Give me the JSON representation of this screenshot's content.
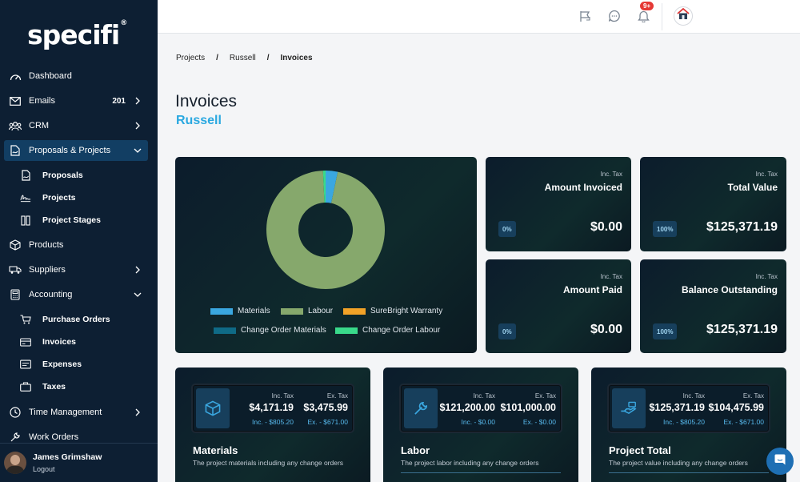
{
  "brand": {
    "logo_text": "specifi",
    "reg_mark": "®"
  },
  "sidebar": {
    "items": [
      {
        "label": "Dashboard",
        "icon": "dashboard-icon"
      },
      {
        "label": "Emails",
        "count": "201",
        "icon": "mail-icon"
      },
      {
        "label": "CRM",
        "icon": "users-icon"
      },
      {
        "label": "Proposals & Projects",
        "icon": "proposals-icon",
        "active": true
      },
      {
        "label": "Products",
        "icon": "box-icon"
      },
      {
        "label": "Suppliers",
        "icon": "truck-icon"
      },
      {
        "label": "Accounting",
        "icon": "calculator-icon"
      },
      {
        "label": "Time Management",
        "icon": "clock-icon"
      },
      {
        "label": "Work Orders",
        "icon": "tools-icon"
      }
    ],
    "projects_sub": [
      {
        "label": "Proposals",
        "icon": "document-icon"
      },
      {
        "label": "Projects",
        "icon": "signature-icon"
      },
      {
        "label": "Project Stages",
        "icon": "columns-icon"
      }
    ],
    "accounting_sub": [
      {
        "label": "Purchase Orders",
        "icon": "cart-icon"
      },
      {
        "label": "Invoices",
        "icon": "invoice-icon"
      },
      {
        "label": "Expenses",
        "icon": "wallet-icon"
      },
      {
        "label": "Taxes",
        "icon": "briefcase-icon"
      }
    ],
    "user": {
      "name": "James Grimshaw",
      "logout": "Logout"
    }
  },
  "topbar": {
    "notification_badge": "9+"
  },
  "breadcrumb": {
    "items": [
      "Projects",
      "Russell",
      "Invoices"
    ],
    "separator": "/"
  },
  "page": {
    "title": "Invoices",
    "subtitle": "Russell"
  },
  "chart_data": {
    "type": "pie",
    "variant": "donut",
    "slices": [
      {
        "label": "Materials",
        "value": 3.3,
        "color": "#3aa7e0"
      },
      {
        "label": "Labour",
        "value": 96.0,
        "color": "#86a86c"
      },
      {
        "label": "SureBright Warranty",
        "value": 0.0,
        "color": "#f2a227"
      },
      {
        "label": "Change Order Materials",
        "value": 0.0,
        "color": "#0f6a86"
      },
      {
        "label": "Change Order Labour",
        "value": 0.7,
        "color": "#39d98a"
      }
    ],
    "legend_placement": "bottom"
  },
  "stats": [
    {
      "inc": "Inc. Tax",
      "title": "Amount Invoiced",
      "pct": "0%",
      "amount": "$0.00"
    },
    {
      "inc": "Inc. Tax",
      "title": "Total Value",
      "pct": "100%",
      "amount": "$125,371.19"
    },
    {
      "inc": "Inc. Tax",
      "title": "Amount Paid",
      "pct": "0%",
      "amount": "$0.00"
    },
    {
      "inc": "Inc. Tax",
      "title": "Balance Outstanding",
      "pct": "100%",
      "amount": "$125,371.19"
    }
  ],
  "summaries": [
    {
      "name": "Materials",
      "desc": "The project materials including any change orders",
      "icon": "box-icon",
      "inc_h": "Inc. Tax",
      "inc_v": "$4,171.19",
      "inc_s": "Inc. - $805.20",
      "ex_h": "Ex. Tax",
      "ex_v": "$3,475.99",
      "ex_s": "Ex. - $671.00"
    },
    {
      "name": "Labor",
      "desc": "The project labor including any change orders",
      "icon": "wrench-icon",
      "inc_h": "Inc. Tax",
      "inc_v": "$121,200.00",
      "inc_s": "Inc. - $0.00",
      "ex_h": "Ex. Tax",
      "ex_v": "$101,000.00",
      "ex_s": "Ex. - $0.00"
    },
    {
      "name": "Project Total",
      "desc": "The project value including any change orders",
      "icon": "hand-money-icon",
      "inc_h": "Inc. Tax",
      "inc_v": "$125,371.19",
      "inc_s": "Inc. - $805.20",
      "ex_h": "Ex. Tax",
      "ex_v": "$104,475.99",
      "ex_s": "Ex. - $671.00"
    }
  ]
}
